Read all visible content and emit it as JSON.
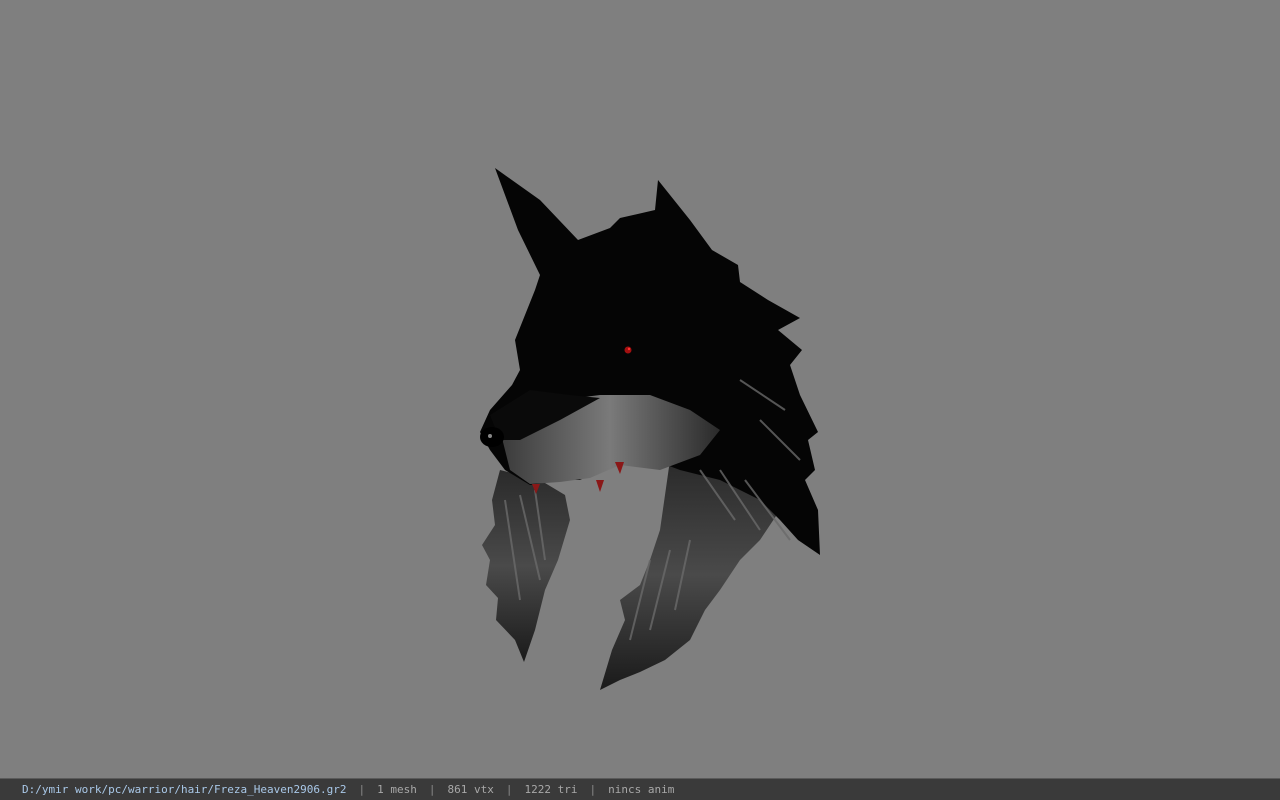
{
  "viewer": {
    "background_color": "#7f7f7f",
    "model_icon": "wolf-head-hair-mesh"
  },
  "status": {
    "file_path": "D:/ymir work/pc/warrior/hair/Freza_Heaven2906.gr2",
    "separator": "|",
    "mesh_count": "1 mesh",
    "vertex_count": "861 vtx",
    "triangle_count": "1222 tri",
    "anim_state": "nincs anim"
  }
}
